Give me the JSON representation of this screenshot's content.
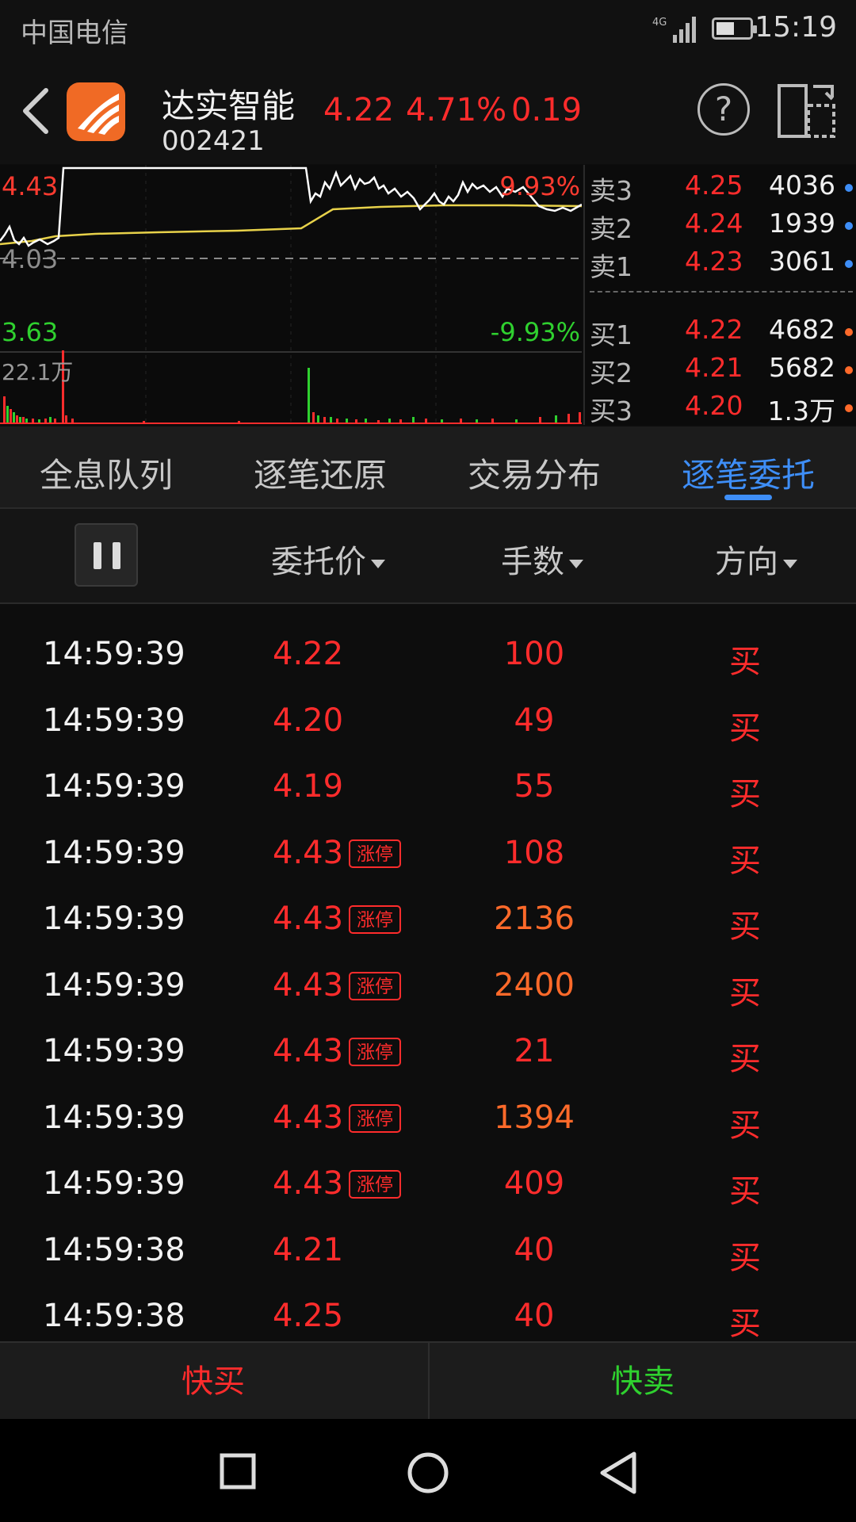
{
  "status_bar": {
    "carrier": "中国电信",
    "network": "4G",
    "time": "15:19"
  },
  "header": {
    "stock_name": "达实智能",
    "stock_code": "002421",
    "price": "4.22",
    "change_pct": "4.71%",
    "change": "0.19",
    "help": "?"
  },
  "chart": {
    "high_label": "4.43",
    "mid_label": "4.03",
    "low_label": "3.63",
    "high_pct": "9.93%",
    "low_pct": "-9.93%",
    "volume_label": "22.1万"
  },
  "order_book": {
    "asks": [
      {
        "label": "卖3",
        "price": "4.25",
        "volume": "4036"
      },
      {
        "label": "卖2",
        "price": "4.24",
        "volume": "1939"
      },
      {
        "label": "卖1",
        "price": "4.23",
        "volume": "3061"
      }
    ],
    "bids": [
      {
        "label": "买1",
        "price": "4.22",
        "volume": "4682"
      },
      {
        "label": "买2",
        "price": "4.21",
        "volume": "5682"
      },
      {
        "label": "买3",
        "price": "4.20",
        "volume": "1.3万"
      }
    ]
  },
  "tabs": [
    "全息队列",
    "逐笔还原",
    "交易分布",
    "逐笔委托"
  ],
  "active_tab": "逐笔委托",
  "columns": {
    "price": "委托价",
    "volume": "手数",
    "direction": "方向"
  },
  "limit_tag": "涨停",
  "trades": [
    {
      "time": "14:59:39",
      "price": "4.22",
      "volume": "100",
      "dir": "买",
      "limit": false
    },
    {
      "time": "14:59:39",
      "price": "4.20",
      "volume": "49",
      "dir": "买",
      "limit": false
    },
    {
      "time": "14:59:39",
      "price": "4.19",
      "volume": "55",
      "dir": "买",
      "limit": false
    },
    {
      "time": "14:59:39",
      "price": "4.43",
      "volume": "108",
      "dir": "买",
      "limit": true
    },
    {
      "time": "14:59:39",
      "price": "4.43",
      "volume": "2136",
      "dir": "买",
      "limit": true
    },
    {
      "time": "14:59:39",
      "price": "4.43",
      "volume": "2400",
      "dir": "买",
      "limit": true
    },
    {
      "time": "14:59:39",
      "price": "4.43",
      "volume": "21",
      "dir": "买",
      "limit": true
    },
    {
      "time": "14:59:39",
      "price": "4.43",
      "volume": "1394",
      "dir": "买",
      "limit": true
    },
    {
      "time": "14:59:39",
      "price": "4.43",
      "volume": "409",
      "dir": "买",
      "limit": true
    },
    {
      "time": "14:59:38",
      "price": "4.21",
      "volume": "40",
      "dir": "买",
      "limit": false
    },
    {
      "time": "14:59:38",
      "price": "4.25",
      "volume": "40",
      "dir": "买",
      "limit": false
    }
  ],
  "actions": {
    "quick_buy": "快买",
    "quick_sell": "快卖"
  },
  "colors": {
    "up": "#ff2c2c",
    "down": "#2fd12f",
    "accent": "#3e8ef7",
    "large_volume": "#ff6a2a",
    "logo": "#f06a25"
  }
}
